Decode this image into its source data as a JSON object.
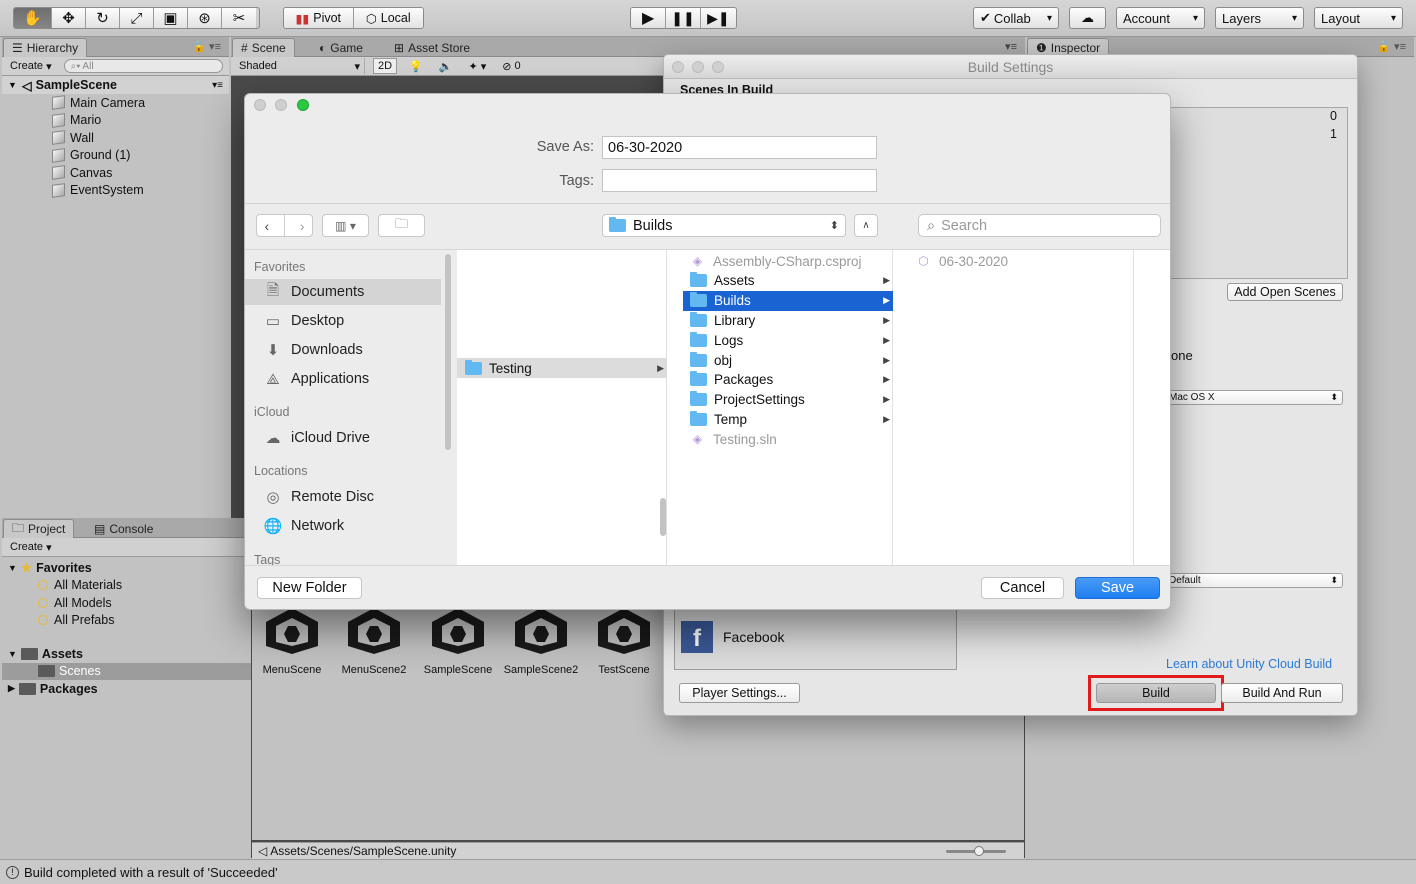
{
  "toolbar": {
    "pivot": "Pivot",
    "local": "Local",
    "collab": "Collab",
    "account": "Account",
    "layers": "Layers",
    "layout": "Layout"
  },
  "hierarchy": {
    "tab": "Hierarchy",
    "create": "Create",
    "search_placeholder": "All",
    "scene": "SampleScene",
    "items": [
      "Main Camera",
      "Mario",
      "Wall",
      "Ground (1)",
      "Canvas",
      "EventSystem"
    ]
  },
  "scene_tabs": {
    "scene": "Scene",
    "game": "Game",
    "asset_store": "Asset Store",
    "shading": "Shaded",
    "mode_2d": "2D",
    "gizmo_count": "0"
  },
  "inspector": {
    "tab": "Inspector"
  },
  "project": {
    "tab_project": "Project",
    "tab_console": "Console",
    "create": "Create",
    "favorites": "Favorites",
    "fav_items": [
      "All Materials",
      "All Models",
      "All Prefabs"
    ],
    "assets": "Assets",
    "scenes": "Scenes",
    "packages": "Packages",
    "scene_assets": [
      "MenuScene",
      "MenuScene2",
      "SampleScene",
      "SampleScene2",
      "TestScene"
    ],
    "path": "Assets/Scenes/SampleScene.unity"
  },
  "status": {
    "message": "Build completed with a result of 'Succeeded'"
  },
  "build_settings": {
    "title": "Build Settings",
    "scenes_in_build": "Scenes In Build",
    "scene_indices": [
      "0",
      "1"
    ],
    "add_open_scenes": "Add Open Scenes",
    "platform_partial": "one",
    "target_platform": "Mac OS X",
    "compression": "Default",
    "facebook": "Facebook",
    "cloud_link": "Learn about Unity Cloud Build",
    "player_settings": "Player Settings...",
    "build": "Build",
    "build_and_run": "Build And Run"
  },
  "save_dialog": {
    "save_as_label": "Save As:",
    "save_as_value": "06-30-2020",
    "tags_label": "Tags:",
    "location": "Builds",
    "search_placeholder": "Search",
    "favorites_header": "Favorites",
    "favorites": [
      "Documents",
      "Desktop",
      "Downloads",
      "Applications"
    ],
    "icloud_header": "iCloud",
    "icloud": [
      "iCloud Drive"
    ],
    "locations_header": "Locations",
    "locations": [
      "Remote Disc",
      "Network"
    ],
    "tags_header": "Tags",
    "col1": [
      "Testing"
    ],
    "col2": [
      "Assembly-CSharp.csproj",
      "Assets",
      "Builds",
      "Library",
      "Logs",
      "obj",
      "Packages",
      "ProjectSettings",
      "Temp",
      "Testing.sln"
    ],
    "col3": [
      "06-30-2020"
    ],
    "new_folder": "New Folder",
    "cancel": "Cancel",
    "save": "Save"
  },
  "colors": {
    "accent": "#1964d2",
    "save_button": "#1e7ef0",
    "highlight_box": "#e01b1b"
  }
}
